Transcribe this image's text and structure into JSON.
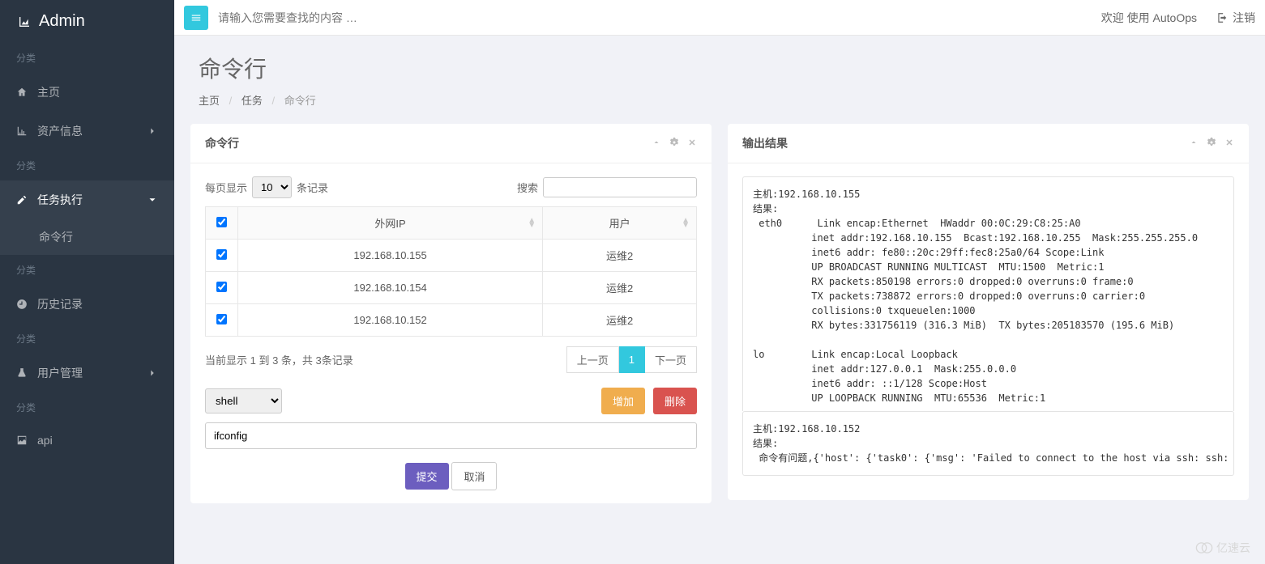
{
  "brand": "Admin",
  "topbar": {
    "search_placeholder": "请输入您需要查找的内容 …",
    "welcome": "欢迎 使用 AutoOps",
    "logout": "注销"
  },
  "sidebar": {
    "sections": [
      {
        "label": "分类",
        "items": [
          {
            "icon": "home",
            "label": "主页"
          },
          {
            "icon": "chart",
            "label": "资产信息",
            "has_children": true
          }
        ]
      },
      {
        "label": "分类",
        "items": [
          {
            "icon": "edit",
            "label": "任务执行",
            "has_children": true,
            "expanded": true,
            "children": [
              {
                "label": "命令行",
                "active": true
              }
            ]
          }
        ]
      },
      {
        "label": "分类",
        "items": [
          {
            "icon": "clock",
            "label": "历史记录"
          }
        ]
      },
      {
        "label": "分类",
        "items": [
          {
            "icon": "flask",
            "label": "用户管理",
            "has_children": true
          }
        ]
      },
      {
        "label": "分类",
        "items": [
          {
            "icon": "picture",
            "label": "api"
          }
        ]
      }
    ]
  },
  "page": {
    "title": "命令行",
    "breadcrumb": {
      "home": "主页",
      "tasks": "任务",
      "current": "命令行"
    }
  },
  "left_panel": {
    "title": "命令行",
    "per_page_prefix": "每页显示",
    "per_page_value": "10",
    "per_page_suffix": "条记录",
    "search_label": "搜索",
    "columns": {
      "ip": "外网IP",
      "user": "用户"
    },
    "rows": [
      {
        "checked": true,
        "ip": "192.168.10.155",
        "user": "运维2"
      },
      {
        "checked": true,
        "ip": "192.168.10.154",
        "user": "运维2"
      },
      {
        "checked": true,
        "ip": "192.168.10.152",
        "user": "运维2"
      }
    ],
    "footer_info": "当前显示 1 到 3 条，共 3条记录",
    "pagination": {
      "prev": "上一页",
      "page1": "1",
      "next": "下一页"
    },
    "shell_select": "shell",
    "add_btn": "增加",
    "del_btn": "删除",
    "command_value": "ifconfig",
    "submit": "提交",
    "cancel": "取消"
  },
  "right_panel": {
    "title": "输出结果",
    "output1": "主机:192.168.10.155\n结果:\n eth0      Link encap:Ethernet  HWaddr 00:0C:29:C8:25:A0\n          inet addr:192.168.10.155  Bcast:192.168.10.255  Mask:255.255.255.0\n          inet6 addr: fe80::20c:29ff:fec8:25a0/64 Scope:Link\n          UP BROADCAST RUNNING MULTICAST  MTU:1500  Metric:1\n          RX packets:850198 errors:0 dropped:0 overruns:0 frame:0\n          TX packets:738872 errors:0 dropped:0 overruns:0 carrier:0\n          collisions:0 txqueuelen:1000\n          RX bytes:331756119 (316.3 MiB)  TX bytes:205183570 (195.6 MiB)\n\nlo        Link encap:Local Loopback\n          inet addr:127.0.0.1  Mask:255.0.0.0\n          inet6 addr: ::1/128 Scope:Host\n          UP LOOPBACK RUNNING  MTU:65536  Metric:1",
    "output2": "主机:192.168.10.152\n结果:\n 命令有问题,{'host': {'task0': {'msg': 'Failed to connect to the host via ssh: ssh: connect to ho"
  },
  "watermark": "亿速云"
}
